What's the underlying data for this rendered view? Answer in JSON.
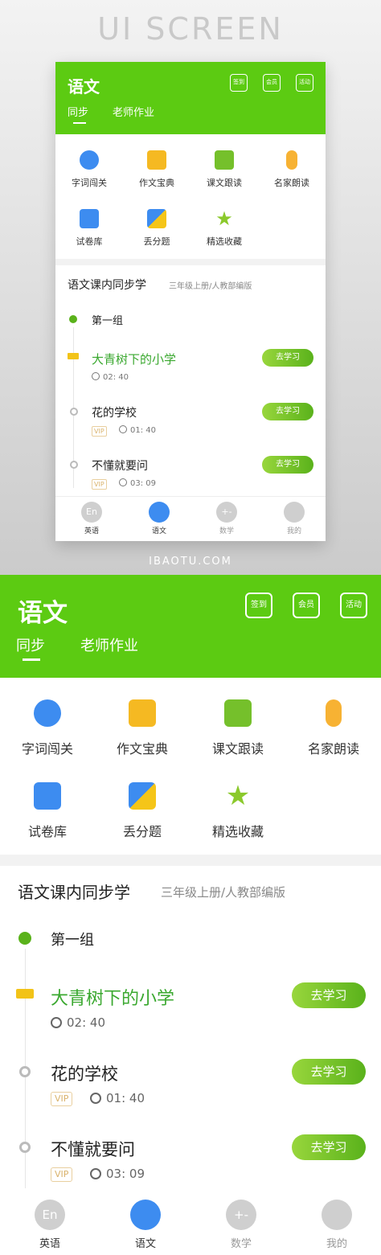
{
  "brand": "UI SCREEN",
  "watermark": "IBAOTU.COM",
  "app": {
    "title": "语文",
    "tabs": [
      "同步",
      "老师作业"
    ],
    "header_icons": [
      "签到",
      "会员",
      "活动"
    ],
    "grid": [
      "字词闯关",
      "作文宝典",
      "课文跟读",
      "名家朗读",
      "试卷库",
      "丢分题",
      "精选收藏"
    ],
    "section_title": "语文课内同步学",
    "section_sub": "三年级上册/人教部编版",
    "group": "第一组",
    "lessons": [
      {
        "name": "大青树下的小学",
        "time": "02: 40",
        "vip": ""
      },
      {
        "name": "花的学校",
        "time": "01: 40",
        "vip": "VIP"
      },
      {
        "name": "不懂就要问",
        "time": "03: 09",
        "vip": "VIP"
      }
    ],
    "study_button": "去学习",
    "nav": [
      {
        "label": "英语",
        "icon": "En"
      },
      {
        "label": "语文",
        "icon": ""
      },
      {
        "label": "数学",
        "icon": "+-"
      },
      {
        "label": "我的",
        "icon": ""
      }
    ]
  },
  "colors": {
    "primary": "#5ccb12",
    "accent_text": "#3aa82f",
    "flag": "#f2c318"
  }
}
